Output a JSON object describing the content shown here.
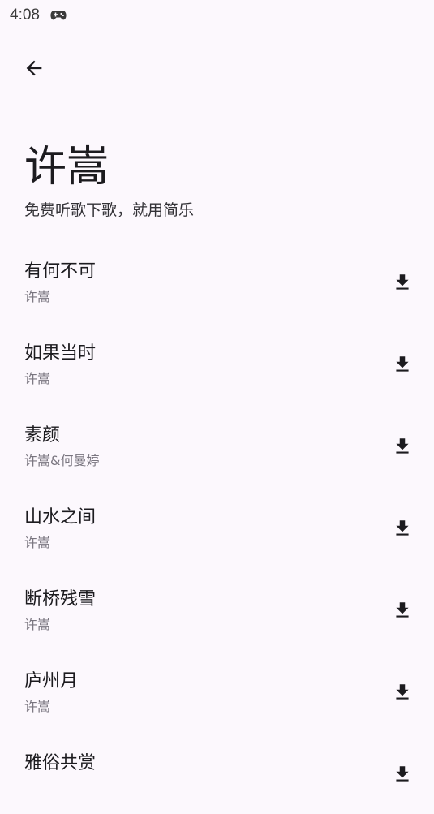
{
  "status_bar": {
    "time": "4:08",
    "notification_icon": "gamepad-icon"
  },
  "header": {
    "back_icon": "arrow-left-icon"
  },
  "page": {
    "title": "许嵩",
    "subtitle": "免费听歌下歌，就用简乐"
  },
  "songs": [
    {
      "title": "有何不可",
      "artist": "许嵩"
    },
    {
      "title": "如果当时",
      "artist": "许嵩"
    },
    {
      "title": "素颜",
      "artist": "许嵩&何曼婷"
    },
    {
      "title": "山水之间",
      "artist": "许嵩"
    },
    {
      "title": "断桥残雪",
      "artist": "许嵩"
    },
    {
      "title": "庐州月",
      "artist": "许嵩"
    },
    {
      "title": "雅俗共赏",
      "artist": ""
    }
  ],
  "download_icon": "download-icon",
  "colors": {
    "background": "#fcf8fd",
    "text_primary": "#1c1b1f",
    "text_secondary": "#79757f"
  }
}
